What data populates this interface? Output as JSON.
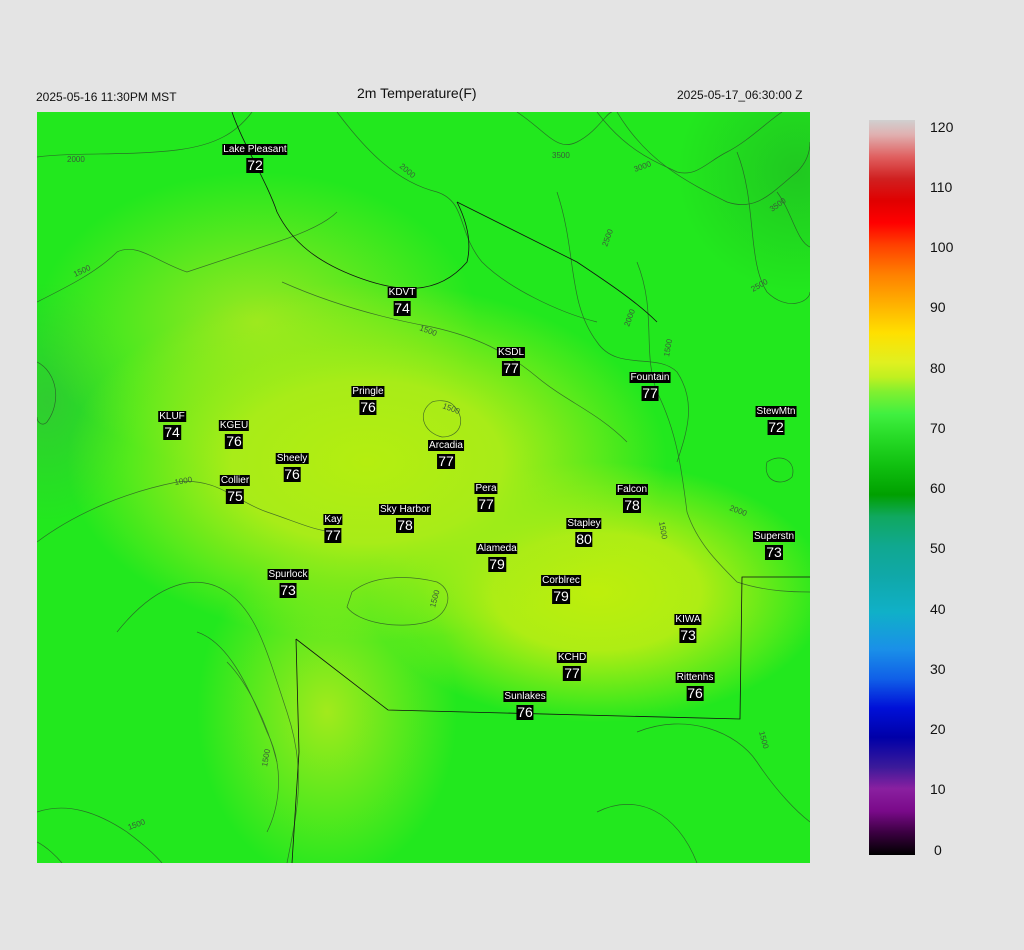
{
  "header": {
    "left_time": "2025-05-16 11:30PM MST",
    "title": "2m Temperature(F)",
    "right_time": "2025-05-17_06:30:00 Z"
  },
  "contour_labels": [
    "2000",
    "2000",
    "3500",
    "3000",
    "3500",
    "2500",
    "2000",
    "2500",
    "1500",
    "1500",
    "1500",
    "1500",
    "1000",
    "1500",
    "2000",
    "1500",
    "1500",
    "1500",
    "1500"
  ],
  "stations": [
    {
      "name": "Lake Pleasant",
      "value": "72"
    },
    {
      "name": "KDVT",
      "value": "74"
    },
    {
      "name": "KSDL",
      "value": "77"
    },
    {
      "name": "Fountain",
      "value": "77"
    },
    {
      "name": "Pringle",
      "value": "76"
    },
    {
      "name": "KLUF",
      "value": "74"
    },
    {
      "name": "KGEU",
      "value": "76"
    },
    {
      "name": "StewMtn",
      "value": "72"
    },
    {
      "name": "Arcadia",
      "value": "77"
    },
    {
      "name": "Sheely",
      "value": "76"
    },
    {
      "name": "Collier",
      "value": "75"
    },
    {
      "name": "Pera",
      "value": "77"
    },
    {
      "name": "Falcon",
      "value": "78"
    },
    {
      "name": "Kay",
      "value": "77"
    },
    {
      "name": "Sky Harbor",
      "value": "78"
    },
    {
      "name": "Stapley",
      "value": "80"
    },
    {
      "name": "Superstn",
      "value": "73"
    },
    {
      "name": "Alameda",
      "value": "79"
    },
    {
      "name": "Spurlock",
      "value": "73"
    },
    {
      "name": "Corblrec",
      "value": "79"
    },
    {
      "name": "KIWA",
      "value": "73"
    },
    {
      "name": "KCHD",
      "value": "77"
    },
    {
      "name": "Rittenhs",
      "value": "76"
    },
    {
      "name": "Sunlakes",
      "value": "76"
    }
  ],
  "colorbar": {
    "labels": [
      "120",
      "110",
      "100",
      "90",
      "80",
      "70",
      "60",
      "50",
      "40",
      "30",
      "20",
      "10",
      "0"
    ]
  }
}
